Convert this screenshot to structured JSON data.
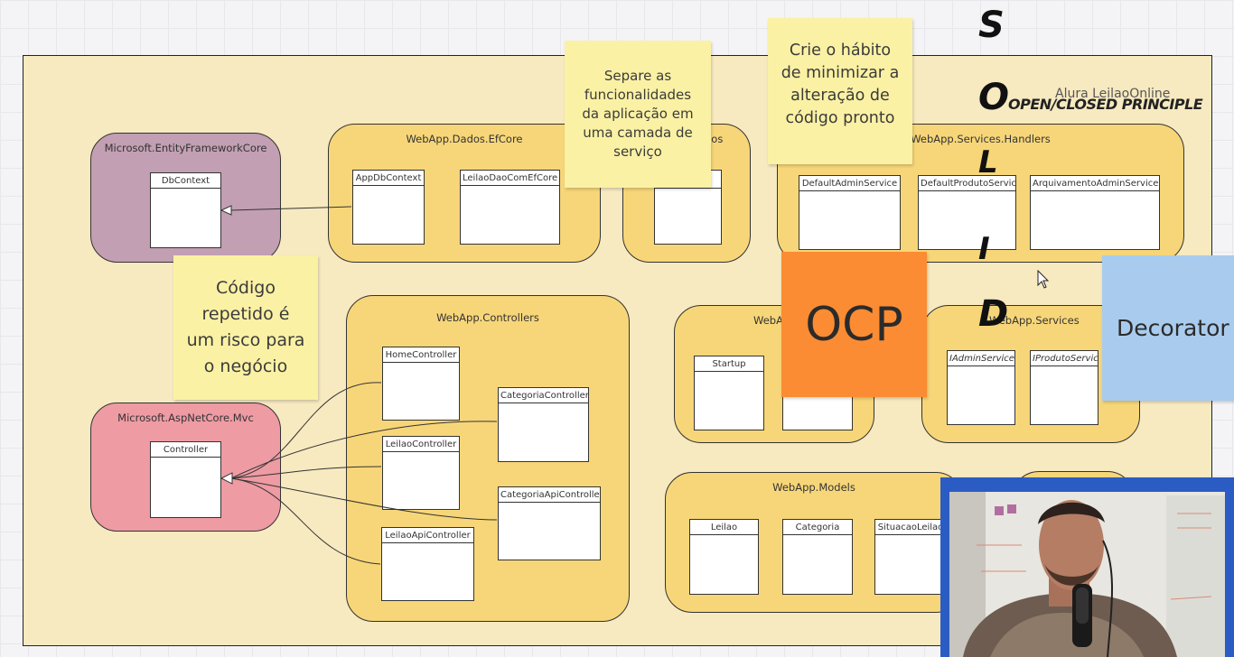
{
  "board": {
    "label": "Alura LeilaoOnline"
  },
  "solid": {
    "letters": [
      "S",
      "O",
      "L",
      "I",
      "D"
    ],
    "open_closed_label": "OPEN/CLOSED PRINCIPLE"
  },
  "packages": {
    "ef_core_ms": {
      "title": "Microsoft.EntityFrameworkCore",
      "classes": {
        "dbcontext": "DbContext"
      }
    },
    "dados_efcore": {
      "title": "WebApp.Dados.EfCore",
      "classes": {
        "appdbcontext": "AppDbContext",
        "leilaodao": "LeilaoDaoComEfCore"
      }
    },
    "dados": {
      "title": "dos"
    },
    "services_handlers": {
      "title": "WebApp.Services.Handlers",
      "classes": {
        "defaultadmin": "DefaultAdminService",
        "defaultproduto": "DefaultProdutoService",
        "arquivamento": "ArquivamentoAdminService"
      }
    },
    "controllers": {
      "title": "WebApp.Controllers",
      "classes": {
        "home": "HomeController",
        "leilao": "LeilaoController",
        "leilaoapi": "LeilaoApiController",
        "categoria": "CategoriaController",
        "categoriaapi": "CategoriaApiController"
      }
    },
    "aspnet_mvc": {
      "title": "Microsoft.AspNetCore.Mvc",
      "classes": {
        "controller": "Controller"
      }
    },
    "webapp": {
      "title": "WebA",
      "classes": {
        "startup": "Startup"
      }
    },
    "services": {
      "title": "WebApp.Services",
      "classes": {
        "iadmin": "IAdminService",
        "iproduto": "IProdutoService"
      }
    },
    "models": {
      "title": "WebApp.Models",
      "classes": {
        "leilao": "Leilao",
        "categoria": "Categoria",
        "situacao": "SituacaoLeilao"
      }
    }
  },
  "stickies": {
    "separe": [
      "Separe as",
      "funcionalidades",
      "da aplicação em",
      "uma camada de",
      "serviço"
    ],
    "crie": [
      "Crie o hábito",
      "de minimizar a",
      "alteração de",
      "código pronto"
    ],
    "codigo": [
      "Código",
      "repetido é",
      "um risco para",
      "o negócio"
    ],
    "ocp": "OCP",
    "decorator": "Decorator"
  },
  "colors": {
    "board": "#f7e9c0",
    "package": "#f7d679",
    "ef_core_package": "#c29fb3",
    "mvc_package": "#ee9ba3",
    "sticky_yellow": "#fbf1a4",
    "sticky_orange": "#fb8c33",
    "sticky_blue": "#a9ccee"
  },
  "icons": {
    "cursor": "mouse-pointer-icon",
    "webcam": "presenter-webcam"
  }
}
